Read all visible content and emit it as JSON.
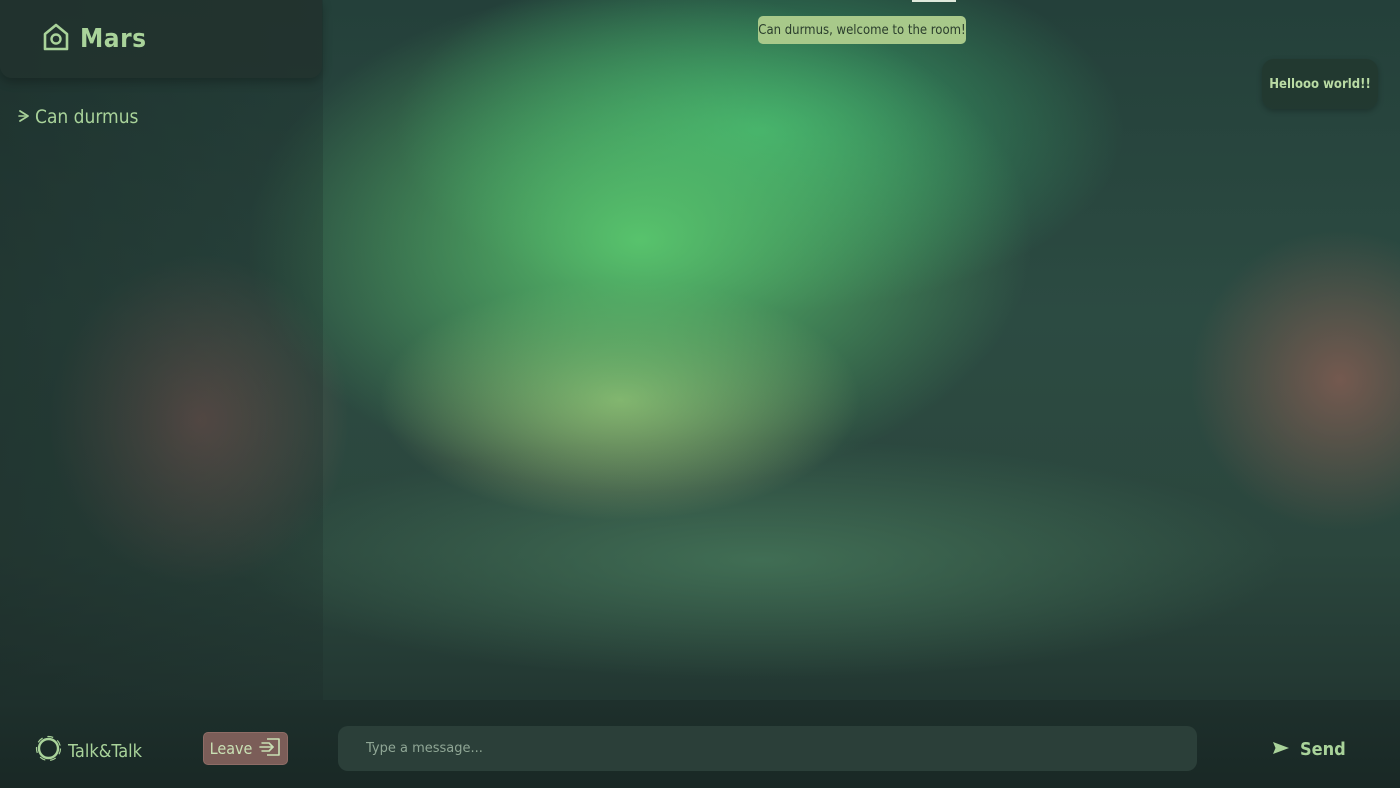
{
  "room": {
    "name": "Mars",
    "icon": "home-icon"
  },
  "users": [
    {
      "name": "Can durmus",
      "icon": "chevron-right-icon"
    }
  ],
  "chat": {
    "system_message": "Can durmus, welcome to the room!",
    "messages": [
      {
        "text": "Hellooo world!!"
      }
    ]
  },
  "footer": {
    "brand": "Talk&Talk",
    "brand_icon": "chat-ring-icon",
    "leave_label": "Leave",
    "leave_icon": "exit-icon",
    "input_placeholder": "Type a message...",
    "send_label": "Send",
    "send_icon": "send-icon"
  },
  "colors": {
    "accent": "#a9d39a",
    "system_bg": "#a8c98a",
    "leave_bg": "#7b5d58",
    "footer_bg": "#1e302c"
  }
}
